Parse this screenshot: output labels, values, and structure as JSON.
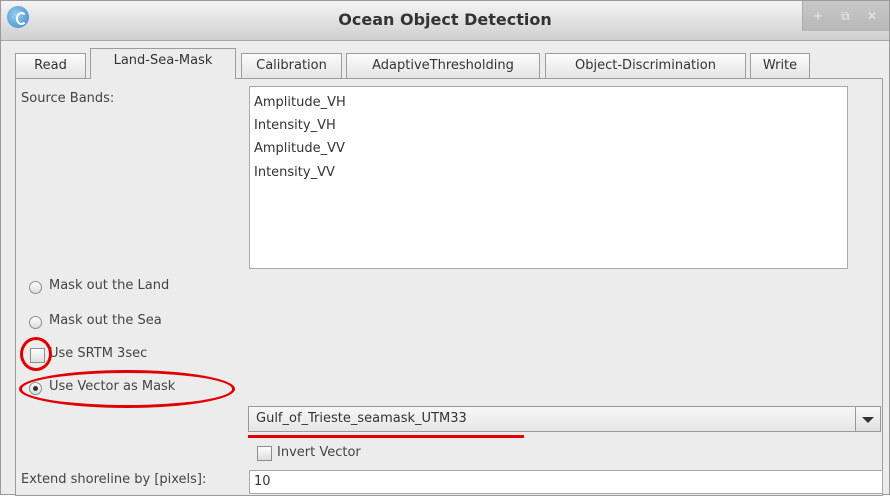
{
  "window": {
    "title": "Ocean Object Detection",
    "controls": [
      "+",
      "⧉",
      "✕"
    ]
  },
  "tabs": [
    {
      "label": "Read",
      "active": false
    },
    {
      "label": "Land-Sea-Mask",
      "active": true
    },
    {
      "label": "Calibration",
      "active": false
    },
    {
      "label": "AdaptiveThresholding",
      "active": false
    },
    {
      "label": "Object-Discrimination",
      "active": false
    },
    {
      "label": "Write",
      "active": false
    }
  ],
  "form": {
    "source_bands_label": "Source Bands:",
    "source_bands": [
      "Amplitude_VH",
      "Intensity_VH",
      "Amplitude_VV",
      "Intensity_VV"
    ],
    "options": {
      "mask_land": {
        "label": "Mask out the Land",
        "selected": false
      },
      "mask_sea": {
        "label": "Mask out the Sea",
        "selected": false
      },
      "use_srtm": {
        "label": "Use SRTM 3sec",
        "checked": false
      },
      "use_vector": {
        "label": "Use Vector as Mask",
        "selected": true
      }
    },
    "vector_select": {
      "value": "Gulf_of_Trieste_seamask_UTM33"
    },
    "invert_vector": {
      "label": "Invert Vector",
      "checked": false
    },
    "extend_shoreline": {
      "label": "Extend shoreline by [pixels]:",
      "value": "10"
    }
  },
  "colors": {
    "annotation": "#e00000",
    "window_bg": "#ececec"
  }
}
